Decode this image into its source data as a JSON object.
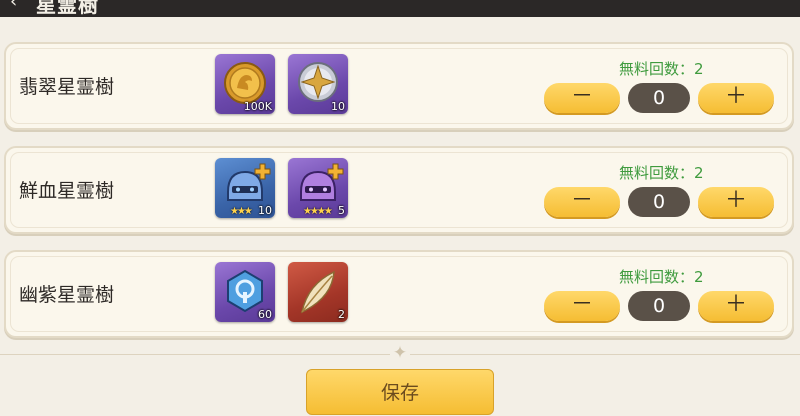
{
  "header": {
    "title": "星霊樹",
    "back_icon": "back-arrow-icon"
  },
  "rows": [
    {
      "name": "翡翠星霊樹",
      "free_label": "無料回数：2",
      "count": "0",
      "minus": "－",
      "plus": "＋",
      "items": [
        {
          "icon": "gold-coin-icon",
          "qty": "100K"
        },
        {
          "icon": "compass-star-icon",
          "qty": "10"
        }
      ]
    },
    {
      "name": "鮮血星霊樹",
      "free_label": "無料回数：2",
      "count": "0",
      "minus": "－",
      "plus": "＋",
      "items": [
        {
          "icon": "blue-helmet-icon",
          "stars": "★★★",
          "qty": "10"
        },
        {
          "icon": "purple-helmet-icon",
          "stars": "★★★★",
          "qty": "5"
        }
      ]
    },
    {
      "name": "幽紫星霊樹",
      "free_label": "無料回数：2",
      "count": "0",
      "minus": "－",
      "plus": "＋",
      "items": [
        {
          "icon": "blue-gem-icon",
          "qty": "60"
        },
        {
          "icon": "feather-icon",
          "qty": "2"
        }
      ]
    }
  ],
  "divider_icon": "sparkle-icon",
  "divider_glyph": "✦",
  "save_label": "保存",
  "colors": {
    "background": "#f3efe6",
    "header": "#2b2827",
    "button_yellow": "#f5bd33",
    "free_green": "#3f9b3e",
    "counter_dark": "#5a5148"
  }
}
